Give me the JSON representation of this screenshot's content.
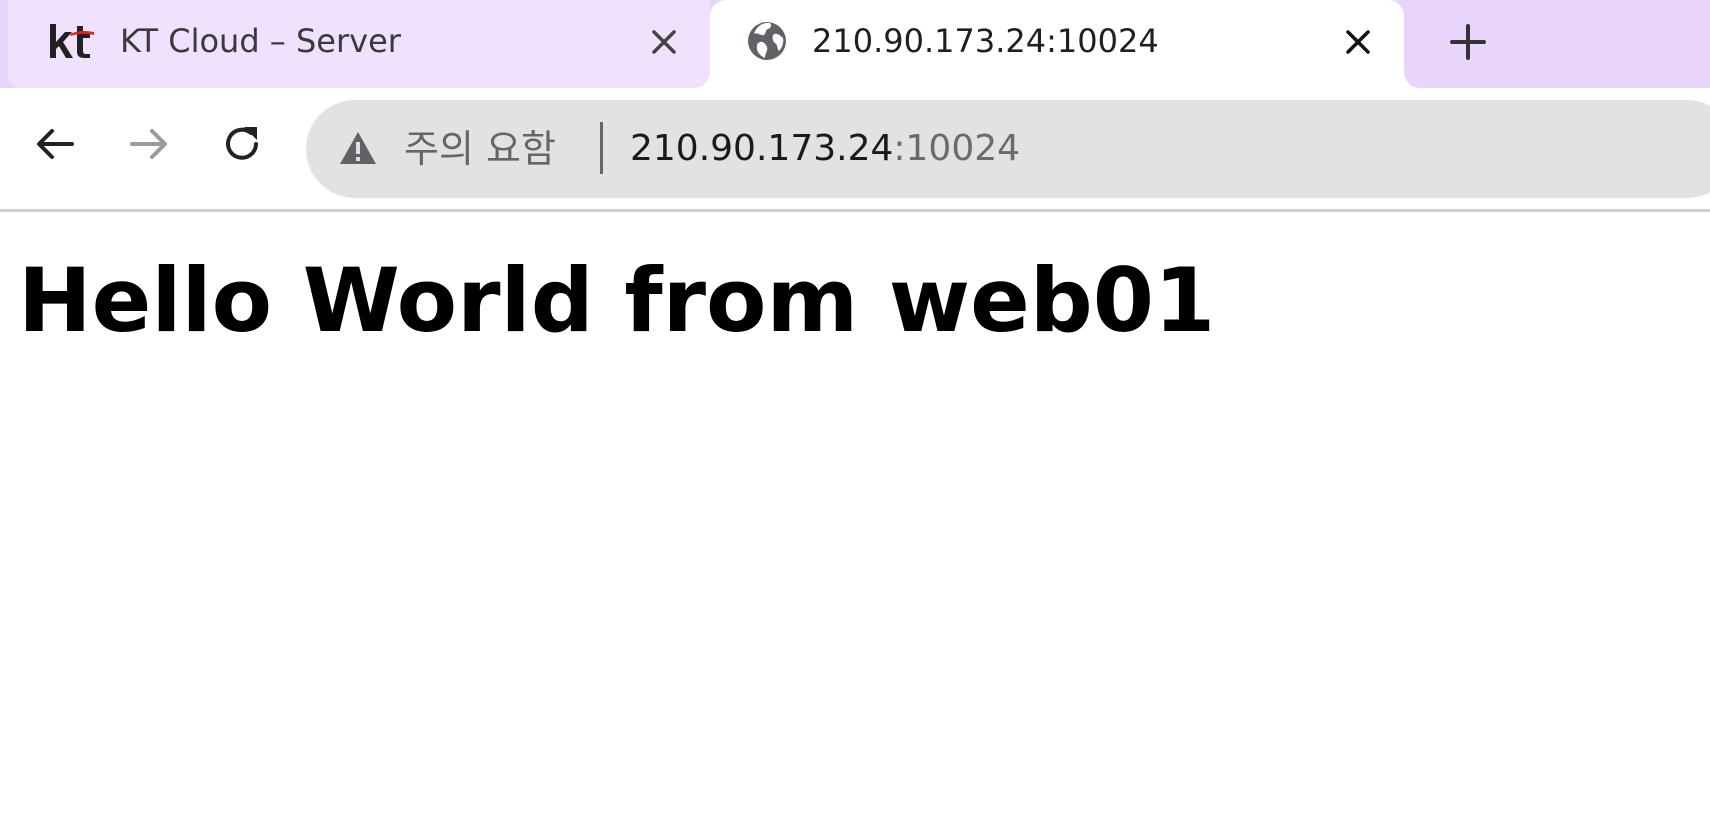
{
  "tabs": [
    {
      "title": "KT Cloud – Server",
      "favicon": "kt-logo-icon",
      "active": false
    },
    {
      "title": "210.90.173.24:10024",
      "favicon": "globe-icon",
      "active": true
    }
  ],
  "new_tab_icon": "plus-icon",
  "toolbar": {
    "back_icon": "arrow-left-icon",
    "forward_icon": "arrow-right-icon",
    "reload_icon": "reload-icon"
  },
  "omnibox": {
    "security_label": "주의 요함",
    "url_host": "210.90.173.24",
    "url_port": ":10024"
  },
  "page": {
    "heading": "Hello World from web01"
  },
  "colors": {
    "tab_strip": "#e9d5fc",
    "inactive_tab": "#f0e1fe",
    "omnibox": "#e2e2e2",
    "kt_logo_red": "#e2231a"
  }
}
